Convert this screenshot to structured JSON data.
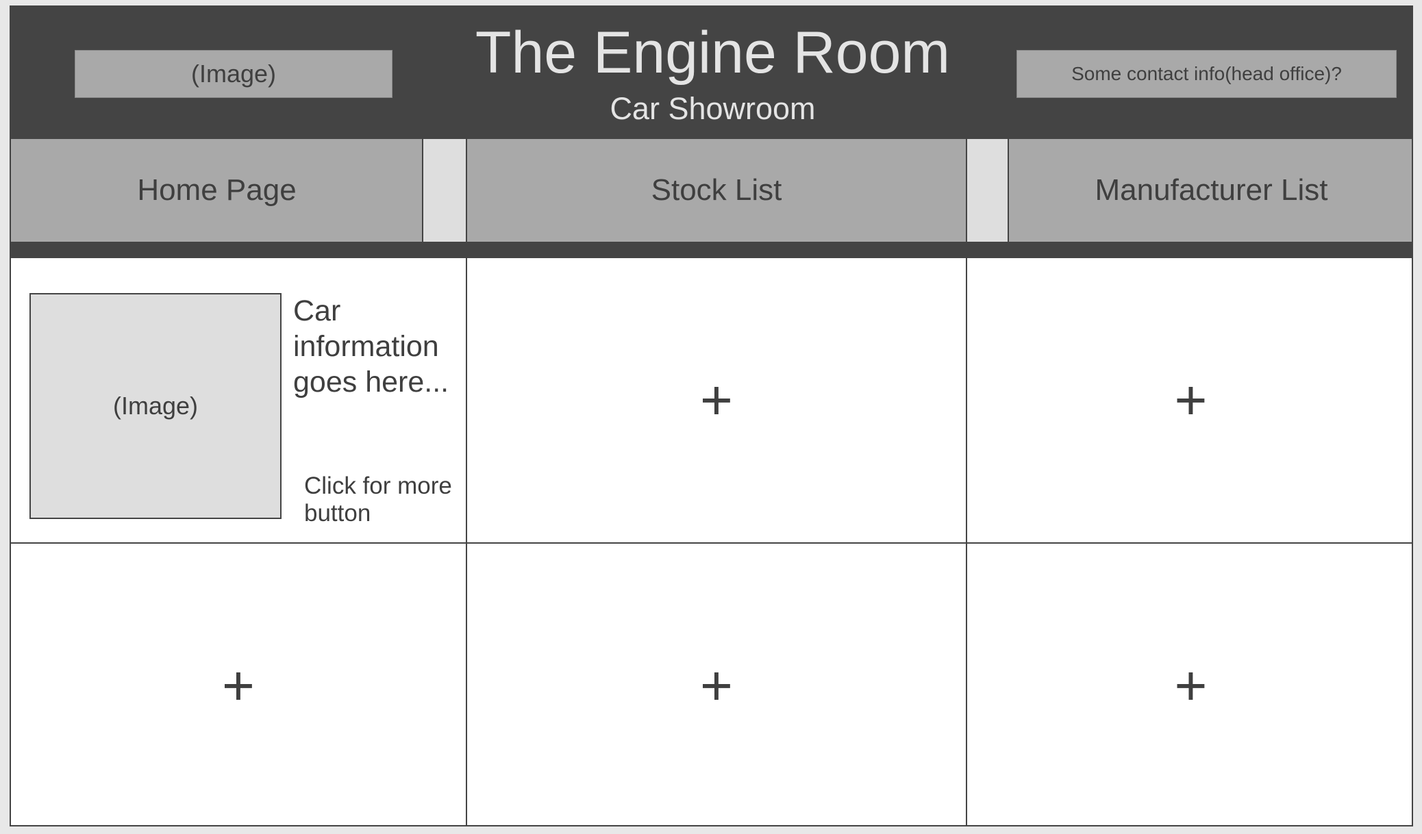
{
  "header": {
    "logo_placeholder": "(Image)",
    "title": "The Engine Room",
    "subtitle": "Car Showroom",
    "contact": "Some contact info(head office)?"
  },
  "nav": {
    "items": [
      {
        "label": "Home Page"
      },
      {
        "label": "Stock List"
      },
      {
        "label": "Manufacturer List"
      }
    ]
  },
  "content": {
    "featured_card": {
      "image_placeholder": "(Image)",
      "info_text": "Car information goes here...",
      "more_button": "Click for more button"
    },
    "add_cells": [
      {
        "symbol": "+"
      },
      {
        "symbol": "+"
      },
      {
        "symbol": "+"
      },
      {
        "symbol": "+"
      },
      {
        "symbol": "+"
      }
    ]
  },
  "colors": {
    "header_bg": "#444444",
    "nav_item_bg": "#a9a9a9",
    "nav_spacer_bg": "#dedede",
    "text_dark": "#3f3f3f",
    "text_light": "#e4e4e4"
  }
}
